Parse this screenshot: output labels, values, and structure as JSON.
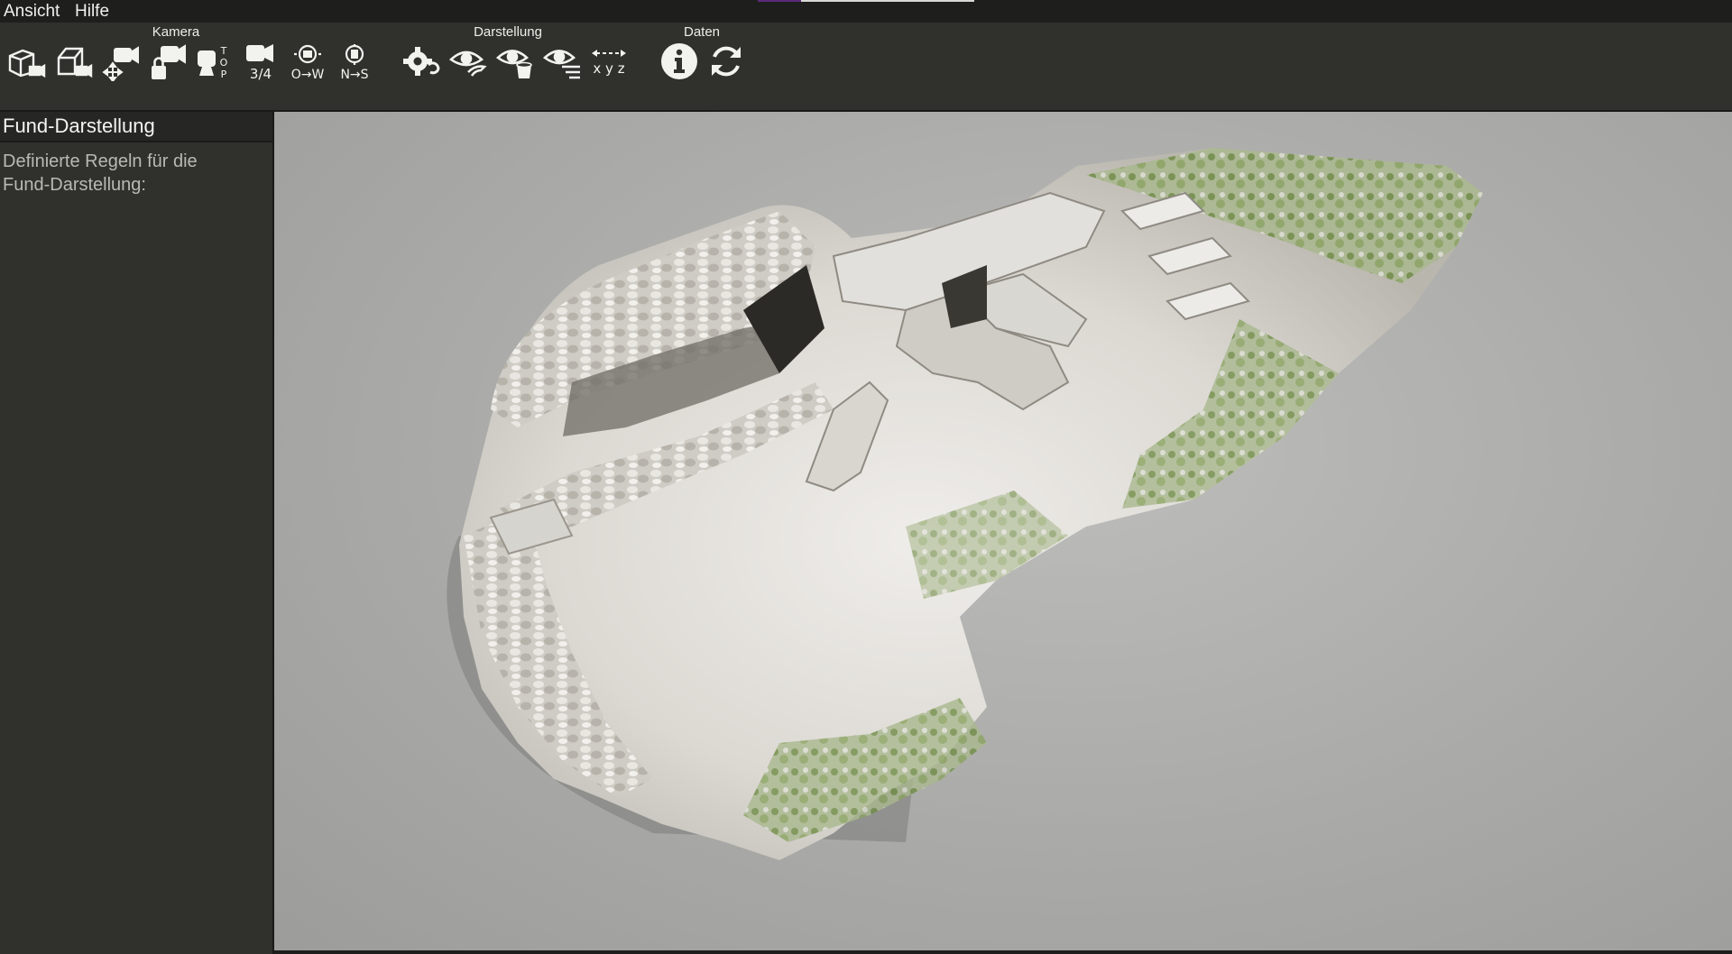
{
  "menu": {
    "items": [
      "Ansicht",
      "Hilfe"
    ]
  },
  "toolbar": {
    "groups": {
      "kamera": "Kamera",
      "darstellung": "Darstellung",
      "daten": "Daten"
    },
    "icon_text": {
      "top": "T O P",
      "three_quarter": "3/4",
      "ow": "O→W",
      "ns": "N→S",
      "xyz": "x y z"
    },
    "tools": [
      {
        "group": "Kamera",
        "icon": "camera-perspective-icon"
      },
      {
        "group": "Kamera",
        "icon": "camera-box-icon"
      },
      {
        "group": "Kamera",
        "icon": "camera-move-icon"
      },
      {
        "group": "Kamera",
        "icon": "camera-lock-icon"
      },
      {
        "group": "Kamera",
        "icon": "camera-top-icon"
      },
      {
        "group": "Kamera",
        "icon": "camera-three-quarter-icon"
      },
      {
        "group": "Kamera",
        "icon": "camera-east-west-icon"
      },
      {
        "group": "Kamera",
        "icon": "camera-north-south-icon"
      },
      {
        "group": "Darstellung",
        "icon": "render-settings-icon"
      },
      {
        "group": "Darstellung",
        "icon": "visibility-hand-icon"
      },
      {
        "group": "Darstellung",
        "icon": "visibility-bucket-icon"
      },
      {
        "group": "Darstellung",
        "icon": "visibility-layers-icon"
      },
      {
        "group": "Darstellung",
        "icon": "axes-xyz-icon"
      },
      {
        "group": "Daten",
        "icon": "info-icon"
      },
      {
        "group": "Daten",
        "icon": "refresh-icon"
      }
    ]
  },
  "panel": {
    "title": "Fund-Darstellung",
    "text_line1": "Definierte Regeln für die",
    "text_line2": "Fund-Darstellung:"
  },
  "colors": {
    "chrome_dark": "#1e1f1c",
    "toolbar_bg": "#30312d",
    "viewport_bg": "#aaaaa8",
    "icon": "#f2f2ef",
    "stone": "#dcdad6",
    "grass": "#7e9a55"
  }
}
